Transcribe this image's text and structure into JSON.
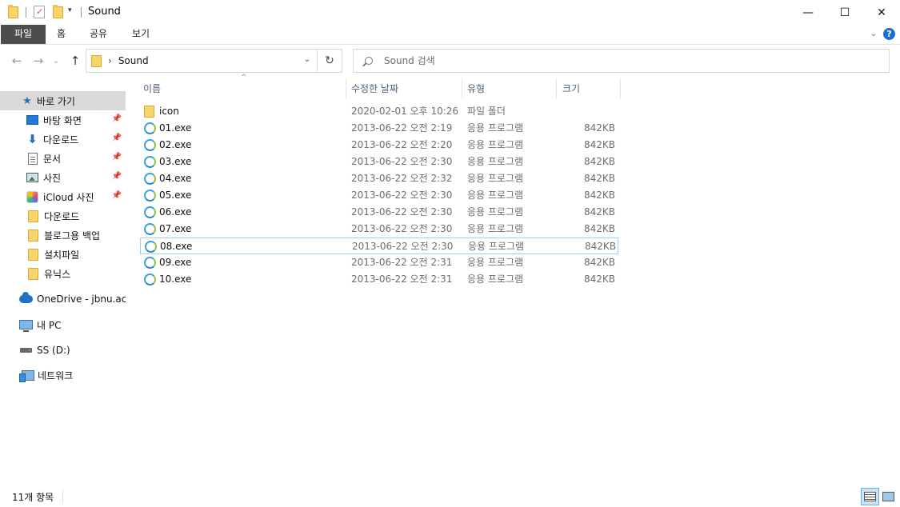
{
  "window": {
    "title": "Sound",
    "qa_dropdown": "▾",
    "minimize": "—",
    "maximize": "☐",
    "close": "✕"
  },
  "ribbon": {
    "tabs": [
      "파일",
      "홈",
      "공유",
      "보기"
    ],
    "expand": "⌄",
    "help": "?"
  },
  "address": {
    "back": "←",
    "forward": "→",
    "recent": "⌄",
    "up": "↑",
    "chevron": "›",
    "path": "Sound",
    "dropdown": "⌄",
    "refresh": "↻",
    "search_placeholder": "Sound 검색"
  },
  "nav": {
    "pin": "📌",
    "items": [
      {
        "label": "바로 가기",
        "icon": "quick-access-star-icon",
        "glyph": "★"
      },
      {
        "label": "바탕 화면",
        "icon": "desktop-icon"
      },
      {
        "label": "다운로드",
        "icon": "download-icon",
        "glyph": "⬇"
      },
      {
        "label": "문서",
        "icon": "documents-icon"
      },
      {
        "label": "사진",
        "icon": "pictures-icon"
      },
      {
        "label": "iCloud 사진",
        "icon": "icloud-photos-icon"
      },
      {
        "label": "다운로드",
        "icon": "folder-icon"
      },
      {
        "label": "블로그용 백업",
        "icon": "folder-icon"
      },
      {
        "label": "설치파일",
        "icon": "folder-icon"
      },
      {
        "label": "유닉스",
        "icon": "folder-icon"
      },
      {
        "label": "OneDrive - jbnu.ac.k",
        "icon": "onedrive-cloud-icon"
      },
      {
        "label": "내 PC",
        "icon": "this-pc-icon"
      },
      {
        "label": "SS (D:)",
        "icon": "drive-icon"
      },
      {
        "label": "네트워크",
        "icon": "network-icon"
      }
    ]
  },
  "columns": {
    "name": "이름",
    "date": "수정한 날짜",
    "type": "유형",
    "size": "크기",
    "sort_indicator": "^"
  },
  "files": [
    {
      "name": "icon",
      "date": "2020-02-01 오후 10:26",
      "type": "파일 폴더",
      "size": "",
      "icon": "folder-icon"
    },
    {
      "name": "01.exe",
      "date": "2013-06-22 오전 2:19",
      "type": "응용 프로그램",
      "size": "842KB",
      "icon": "application-icon"
    },
    {
      "name": "02.exe",
      "date": "2013-06-22 오전 2:20",
      "type": "응용 프로그램",
      "size": "842KB",
      "icon": "application-icon"
    },
    {
      "name": "03.exe",
      "date": "2013-06-22 오전 2:30",
      "type": "응용 프로그램",
      "size": "842KB",
      "icon": "application-icon"
    },
    {
      "name": "04.exe",
      "date": "2013-06-22 오전 2:32",
      "type": "응용 프로그램",
      "size": "842KB",
      "icon": "application-icon"
    },
    {
      "name": "05.exe",
      "date": "2013-06-22 오전 2:30",
      "type": "응용 프로그램",
      "size": "842KB",
      "icon": "application-icon"
    },
    {
      "name": "06.exe",
      "date": "2013-06-22 오전 2:30",
      "type": "응용 프로그램",
      "size": "842KB",
      "icon": "application-icon"
    },
    {
      "name": "07.exe",
      "date": "2013-06-22 오전 2:30",
      "type": "응용 프로그램",
      "size": "842KB",
      "icon": "application-icon"
    },
    {
      "name": "08.exe",
      "date": "2013-06-22 오전 2:30",
      "type": "응용 프로그램",
      "size": "842KB",
      "icon": "application-icon"
    },
    {
      "name": "09.exe",
      "date": "2013-06-22 오전 2:31",
      "type": "응용 프로그램",
      "size": "842KB",
      "icon": "application-icon"
    },
    {
      "name": "10.exe",
      "date": "2013-06-22 오전 2:31",
      "type": "응용 프로그램",
      "size": "842KB",
      "icon": "application-icon"
    }
  ],
  "status": {
    "item_count": "11개 항목"
  }
}
